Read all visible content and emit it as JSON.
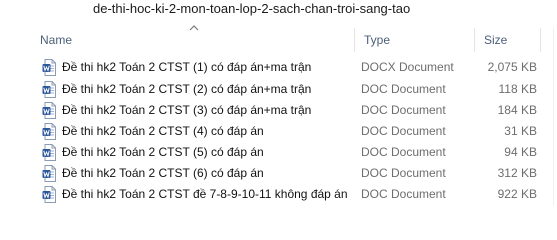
{
  "path": "de-thi-hoc-ki-2-mon-toan-lop-2-sach-chan-troi-sang-tao",
  "columns": {
    "name": "Name",
    "type": "Type",
    "size": "Size"
  },
  "files": [
    {
      "name": "Đề thi hk2 Toán 2 CTST (1) có đáp án+ma trận",
      "type": "DOCX Document",
      "size": "2,075 KB",
      "icon": "word-doc-icon"
    },
    {
      "name": "Đề thi hk2 Toán 2 CTST (2) có đáp án+ma trận",
      "type": "DOC Document",
      "size": "118 KB",
      "icon": "word-doc-icon"
    },
    {
      "name": "Đề thi hk2 Toán 2 CTST (3) có đáp án+ma trận",
      "type": "DOC Document",
      "size": "184 KB",
      "icon": "word-doc-icon"
    },
    {
      "name": "Đề thi hk2 Toán 2 CTST (4) có đáp án",
      "type": "DOC Document",
      "size": "31 KB",
      "icon": "word-doc-icon"
    },
    {
      "name": "Đề thi hk2 Toán 2 CTST (5) có đáp án",
      "type": "DOC Document",
      "size": "94 KB",
      "icon": "word-doc-icon"
    },
    {
      "name": "Đề thi hk2 Toán 2 CTST (6) có đáp án",
      "type": "DOC Document",
      "size": "312 KB",
      "icon": "word-doc-icon"
    },
    {
      "name": "Đề thi hk2 Toán 2 CTST đề 7-8-9-10-11 không đáp án",
      "type": "DOC Document",
      "size": "922 KB",
      "icon": "word-doc-icon"
    }
  ],
  "colors": {
    "header_text": "#4c607a",
    "word_blue": "#2b579a",
    "muted_text": "#6d6d6d"
  }
}
